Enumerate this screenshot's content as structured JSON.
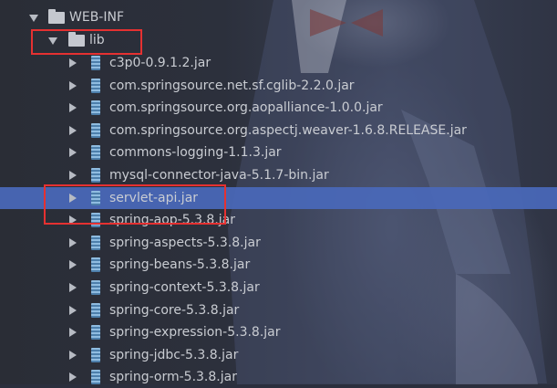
{
  "tree": {
    "root": {
      "label": "WEB-INF",
      "expanded": true
    },
    "lib": {
      "label": "lib",
      "expanded": true
    },
    "jars": [
      {
        "label": "c3p0-0.9.1.2.jar",
        "selected": false
      },
      {
        "label": "com.springsource.net.sf.cglib-2.2.0.jar",
        "selected": false
      },
      {
        "label": "com.springsource.org.aopalliance-1.0.0.jar",
        "selected": false
      },
      {
        "label": "com.springsource.org.aspectj.weaver-1.6.8.RELEASE.jar",
        "selected": false
      },
      {
        "label": "commons-logging-1.1.3.jar",
        "selected": false
      },
      {
        "label": "mysql-connector-java-5.1.7-bin.jar",
        "selected": false
      },
      {
        "label": "servlet-api.jar",
        "selected": true
      },
      {
        "label": "spring-aop-5.3.8.jar",
        "selected": false
      },
      {
        "label": "spring-aspects-5.3.8.jar",
        "selected": false
      },
      {
        "label": "spring-beans-5.3.8.jar",
        "selected": false
      },
      {
        "label": "spring-context-5.3.8.jar",
        "selected": false
      },
      {
        "label": "spring-core-5.3.8.jar",
        "selected": false
      },
      {
        "label": "spring-expression-5.3.8.jar",
        "selected": false
      },
      {
        "label": "spring-jdbc-5.3.8.jar",
        "selected": false
      },
      {
        "label": "spring-orm-5.3.8.jar",
        "selected": false
      }
    ]
  },
  "colors": {
    "selection": "#4968b9",
    "highlight_box": "#e53131",
    "text": "#c9ccd2",
    "jar_icon": "#6a9ec9"
  }
}
